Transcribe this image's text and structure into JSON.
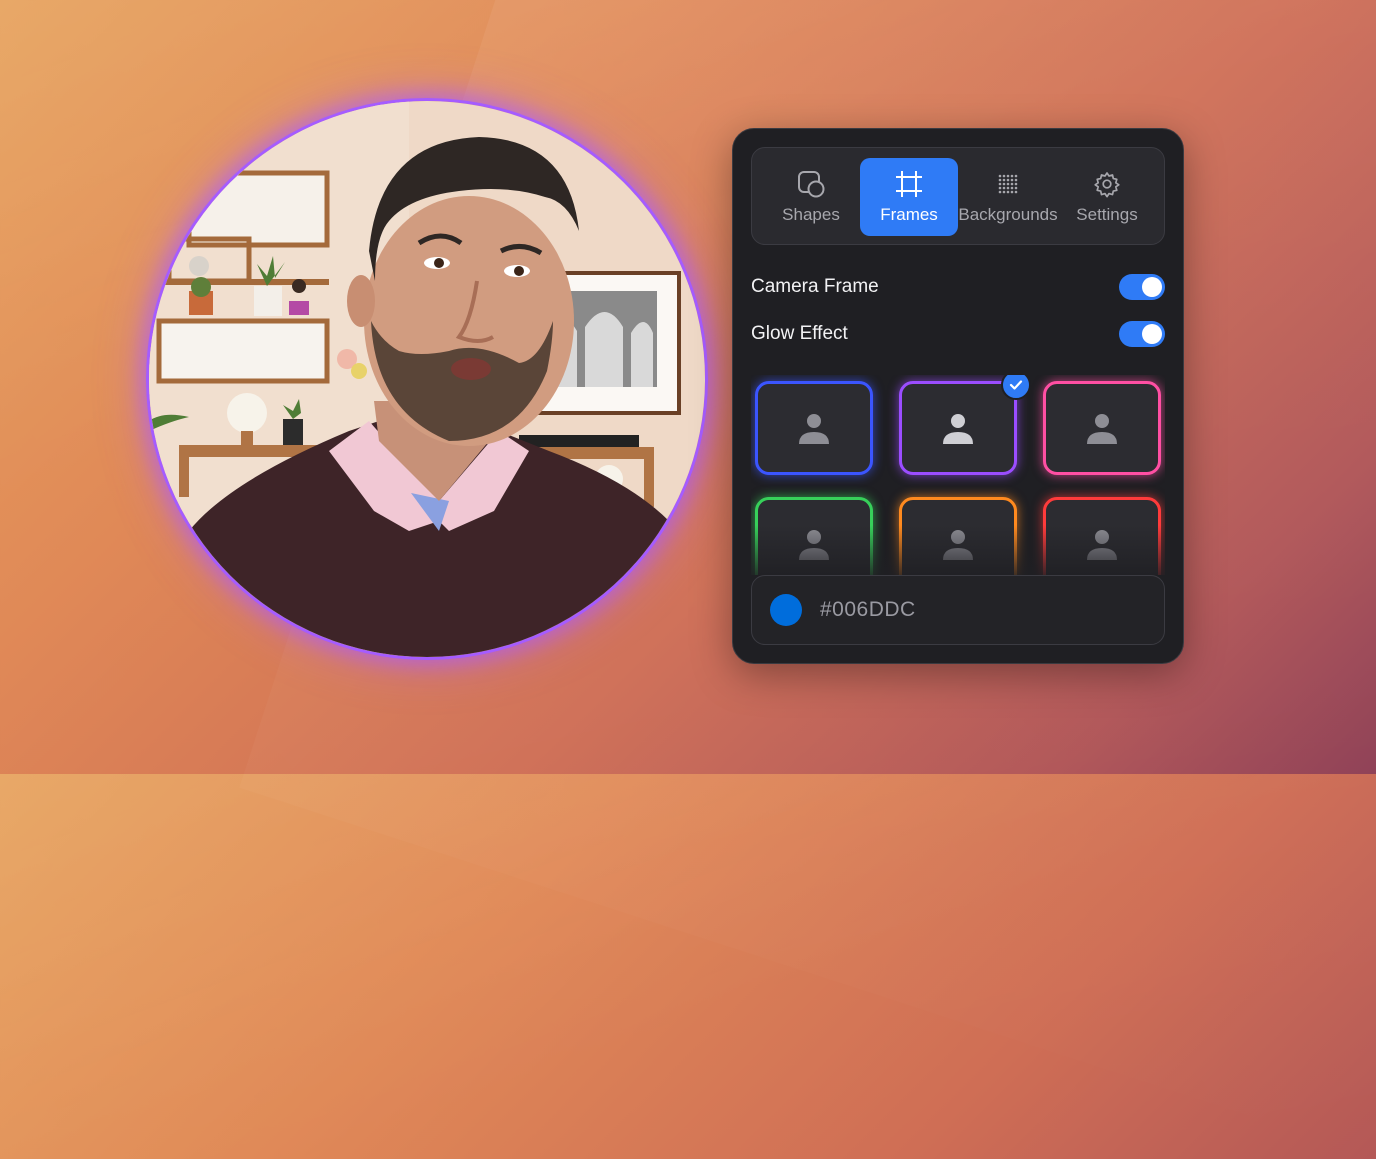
{
  "tabs": [
    {
      "label": "Shapes",
      "icon": "shapes-icon",
      "active": false
    },
    {
      "label": "Frames",
      "icon": "frame-crop-icon",
      "active": true
    },
    {
      "label": "Backgrounds",
      "icon": "dot-grid-icon",
      "active": false
    },
    {
      "label": "Settings",
      "icon": "gear-icon",
      "active": false
    }
  ],
  "toggles": {
    "camera_frame": {
      "label": "Camera Frame",
      "on": true
    },
    "glow_effect": {
      "label": "Glow Effect",
      "on": true
    }
  },
  "frames": [
    {
      "color": "#3b55ff",
      "selected": false
    },
    {
      "color": "#9b4dff",
      "selected": true
    },
    {
      "color": "#ff4fa3",
      "selected": false
    },
    {
      "color": "#37d05a",
      "selected": false
    },
    {
      "color": "#ff8a1f",
      "selected": false
    },
    {
      "color": "#ff3b3b",
      "selected": false
    }
  ],
  "color_field": {
    "value": "#006DDC",
    "swatch": "#006DDC"
  },
  "accent": "#2f7bf6",
  "camera_frame_color": "#a55cff"
}
